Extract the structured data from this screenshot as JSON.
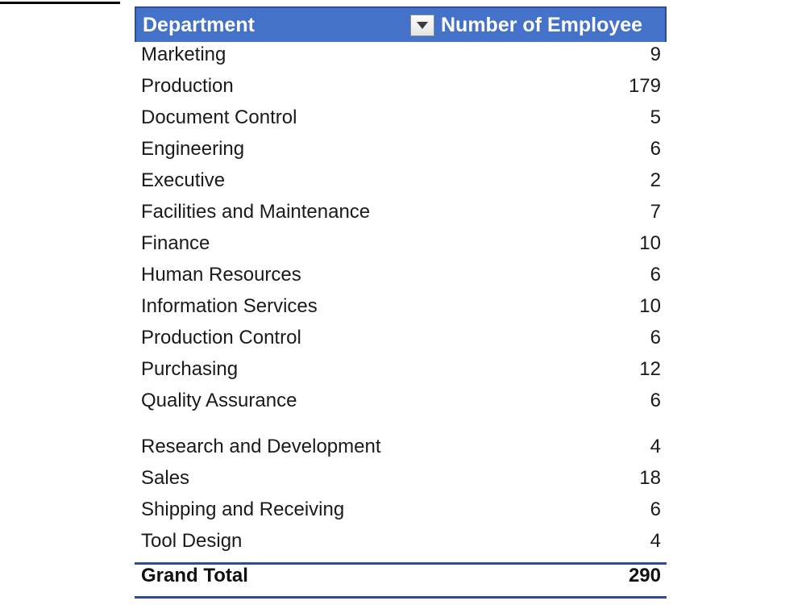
{
  "decorations": {
    "top_left_rule": true
  },
  "colors": {
    "header_fill": "#4472C8",
    "header_border": "#2C4D9B",
    "header_text": "#FFFFFF",
    "body_text": "#1A1A1A",
    "total_rule": "#2C4D9B"
  },
  "pivot_table": {
    "columns": [
      {
        "key": "department",
        "label": "Department",
        "align": "left",
        "has_filter": true
      },
      {
        "key": "employees",
        "label": "Number of Employee",
        "align": "right",
        "has_filter": false
      }
    ],
    "filter_icon": "chevron-down-icon",
    "rows": [
      {
        "label": "Marketing",
        "value": "9",
        "spacer": false
      },
      {
        "label": "Production",
        "value": "179",
        "spacer": false
      },
      {
        "label": "Document Control",
        "value": "5",
        "spacer": false
      },
      {
        "label": "Engineering",
        "value": "6",
        "spacer": false
      },
      {
        "label": "Executive",
        "value": "2",
        "spacer": false
      },
      {
        "label": "Facilities and Maintenance",
        "value": "7",
        "spacer": false
      },
      {
        "label": "Finance",
        "value": "10",
        "spacer": false
      },
      {
        "label": "Human Resources",
        "value": "6",
        "spacer": false
      },
      {
        "label": "Information Services",
        "value": "10",
        "spacer": false
      },
      {
        "label": "Production Control",
        "value": "6",
        "spacer": false
      },
      {
        "label": "Purchasing",
        "value": "12",
        "spacer": false
      },
      {
        "label": "Quality Assurance",
        "value": "6",
        "spacer": false
      },
      {
        "label": "",
        "value": "",
        "spacer": true
      },
      {
        "label": "Research and Development",
        "value": "4",
        "spacer": false
      },
      {
        "label": "Sales",
        "value": "18",
        "spacer": false
      },
      {
        "label": "Shipping and Receiving",
        "value": "6",
        "spacer": false
      },
      {
        "label": "Tool Design",
        "value": "4",
        "spacer": false
      }
    ],
    "grand_total": {
      "label": "Grand Total",
      "value": "290"
    }
  }
}
